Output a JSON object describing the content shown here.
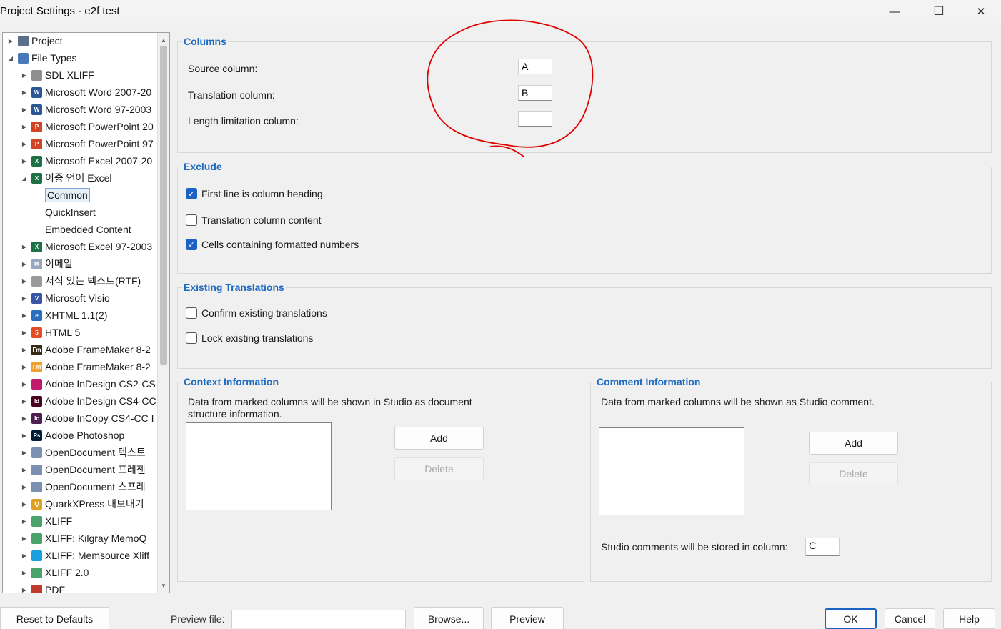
{
  "window": {
    "title": "Project Settings - e2f test",
    "minimize": "—",
    "maximize": "☐",
    "close": "✕"
  },
  "tree": [
    {
      "label": "Project",
      "icon": "project-icon",
      "color": "#5b6f8a",
      "glyph": ""
    },
    {
      "label": "File Types",
      "icon": "filetypes-icon",
      "color": "#4a79b8",
      "glyph": ""
    },
    {
      "label": "SDL XLIFF",
      "icon": "sdl-xliff-icon",
      "color": "#8f8f8f",
      "glyph": ""
    },
    {
      "label": "Microsoft Word 2007-20",
      "icon": "word-icon",
      "color": "#2b5797",
      "glyph": "W"
    },
    {
      "label": "Microsoft Word 97-2003",
      "icon": "word-icon",
      "color": "#2b5797",
      "glyph": "W"
    },
    {
      "label": "Microsoft PowerPoint 20",
      "icon": "powerpoint-icon",
      "color": "#d04525",
      "glyph": "P"
    },
    {
      "label": "Microsoft PowerPoint 97",
      "icon": "powerpoint-icon",
      "color": "#d04525",
      "glyph": "P"
    },
    {
      "label": "Microsoft Excel 2007-20",
      "icon": "excel-icon",
      "color": "#1e7145",
      "glyph": "X"
    },
    {
      "label": "이중 언어 Excel",
      "icon": "excel-icon",
      "color": "#1e7145",
      "glyph": "X"
    },
    {
      "label": "Common",
      "icon": "",
      "color": "",
      "glyph": ""
    },
    {
      "label": "QuickInsert",
      "icon": "",
      "color": "",
      "glyph": ""
    },
    {
      "label": "Embedded Content",
      "icon": "",
      "color": "",
      "glyph": ""
    },
    {
      "label": "Microsoft Excel 97-2003",
      "icon": "excel-icon",
      "color": "#1e7145",
      "glyph": "X"
    },
    {
      "label": "이메일",
      "icon": "email-icon",
      "color": "#9aa8bd",
      "glyph": "✉"
    },
    {
      "label": "서식 있는 텍스트(RTF)",
      "icon": "rtf-icon",
      "color": "#9a9a9a",
      "glyph": ""
    },
    {
      "label": "Microsoft Visio",
      "icon": "visio-icon",
      "color": "#3955a3",
      "glyph": "V"
    },
    {
      "label": "XHTML 1.1(2)",
      "icon": "xhtml-icon",
      "color": "#2a6fbf",
      "glyph": "e"
    },
    {
      "label": "HTML 5",
      "icon": "html5-icon",
      "color": "#e34c26",
      "glyph": "5"
    },
    {
      "label": "Adobe FrameMaker 8-2",
      "icon": "framemaker-icon",
      "color": "#3a2a14",
      "glyph": "Fm"
    },
    {
      "label": "Adobe FrameMaker 8-2",
      "icon": "framemaker-icon",
      "color": "#f0a030",
      "glyph": "FM"
    },
    {
      "label": "Adobe InDesign CS2-CS",
      "icon": "indesign-icon",
      "color": "#c21a6c",
      "glyph": ""
    },
    {
      "label": "Adobe InDesign CS4-CC",
      "icon": "indesign-icon",
      "color": "#49021f",
      "glyph": "Id"
    },
    {
      "label": "Adobe InCopy CS4-CC I",
      "icon": "incopy-icon",
      "color": "#4b1f4f",
      "glyph": "Ic"
    },
    {
      "label": "Adobe Photoshop",
      "icon": "photoshop-icon",
      "color": "#001e36",
      "glyph": "Ps"
    },
    {
      "label": "OpenDocument 텍스트",
      "icon": "opendocument-icon",
      "color": "#7b8fb0",
      "glyph": ""
    },
    {
      "label": "OpenDocument 프레젠",
      "icon": "opendocument-icon",
      "color": "#7b8fb0",
      "glyph": ""
    },
    {
      "label": "OpenDocument 스프레",
      "icon": "opendocument-icon",
      "color": "#7b8fb0",
      "glyph": ""
    },
    {
      "label": "QuarkXPress 내보내기",
      "icon": "quark-icon",
      "color": "#e0a020",
      "glyph": "Q"
    },
    {
      "label": "XLIFF",
      "icon": "xliff-icon",
      "color": "#4aa36a",
      "glyph": ""
    },
    {
      "label": "XLIFF: Kilgray MemoQ",
      "icon": "xliff-icon",
      "color": "#4aa36a",
      "glyph": ""
    },
    {
      "label": "XLIFF: Memsource Xliff",
      "icon": "memsource-icon",
      "color": "#1aa0e0",
      "glyph": ""
    },
    {
      "label": "XLIFF 2.0",
      "icon": "xliff-icon",
      "color": "#4aa36a",
      "glyph": ""
    },
    {
      "label": "PDF",
      "icon": "pdf-icon",
      "color": "#c0392b",
      "glyph": ""
    }
  ],
  "columns": {
    "title": "Columns",
    "source_label": "Source column:",
    "source_value": "A",
    "translation_label": "Translation column:",
    "translation_value": "B",
    "length_label": "Length limitation column:",
    "length_value": ""
  },
  "exclude": {
    "title": "Exclude",
    "first_line": "First line is column heading",
    "translation_content": "Translation column content",
    "formatted_numbers": "Cells containing formatted numbers"
  },
  "existing": {
    "title": "Existing Translations",
    "confirm": "Confirm existing translations",
    "lock": "Lock existing translations"
  },
  "context": {
    "title": "Context Information",
    "desc": "Data from marked columns will be shown in Studio as document structure information.",
    "add": "Add",
    "delete": "Delete"
  },
  "comment": {
    "title": "Comment Information",
    "desc": "Data from marked columns will be shown as Studio comment.",
    "add": "Add",
    "delete": "Delete",
    "stored_label": "Studio comments will be stored in column:",
    "stored_value": "C"
  },
  "bottom": {
    "reset": "Reset to Defaults",
    "preview_label": "Preview file:",
    "preview_value": "",
    "browse": "Browse...",
    "preview": "Preview",
    "ok": "OK",
    "cancel": "Cancel",
    "help": "Help"
  },
  "annotation_color": "#e00000"
}
